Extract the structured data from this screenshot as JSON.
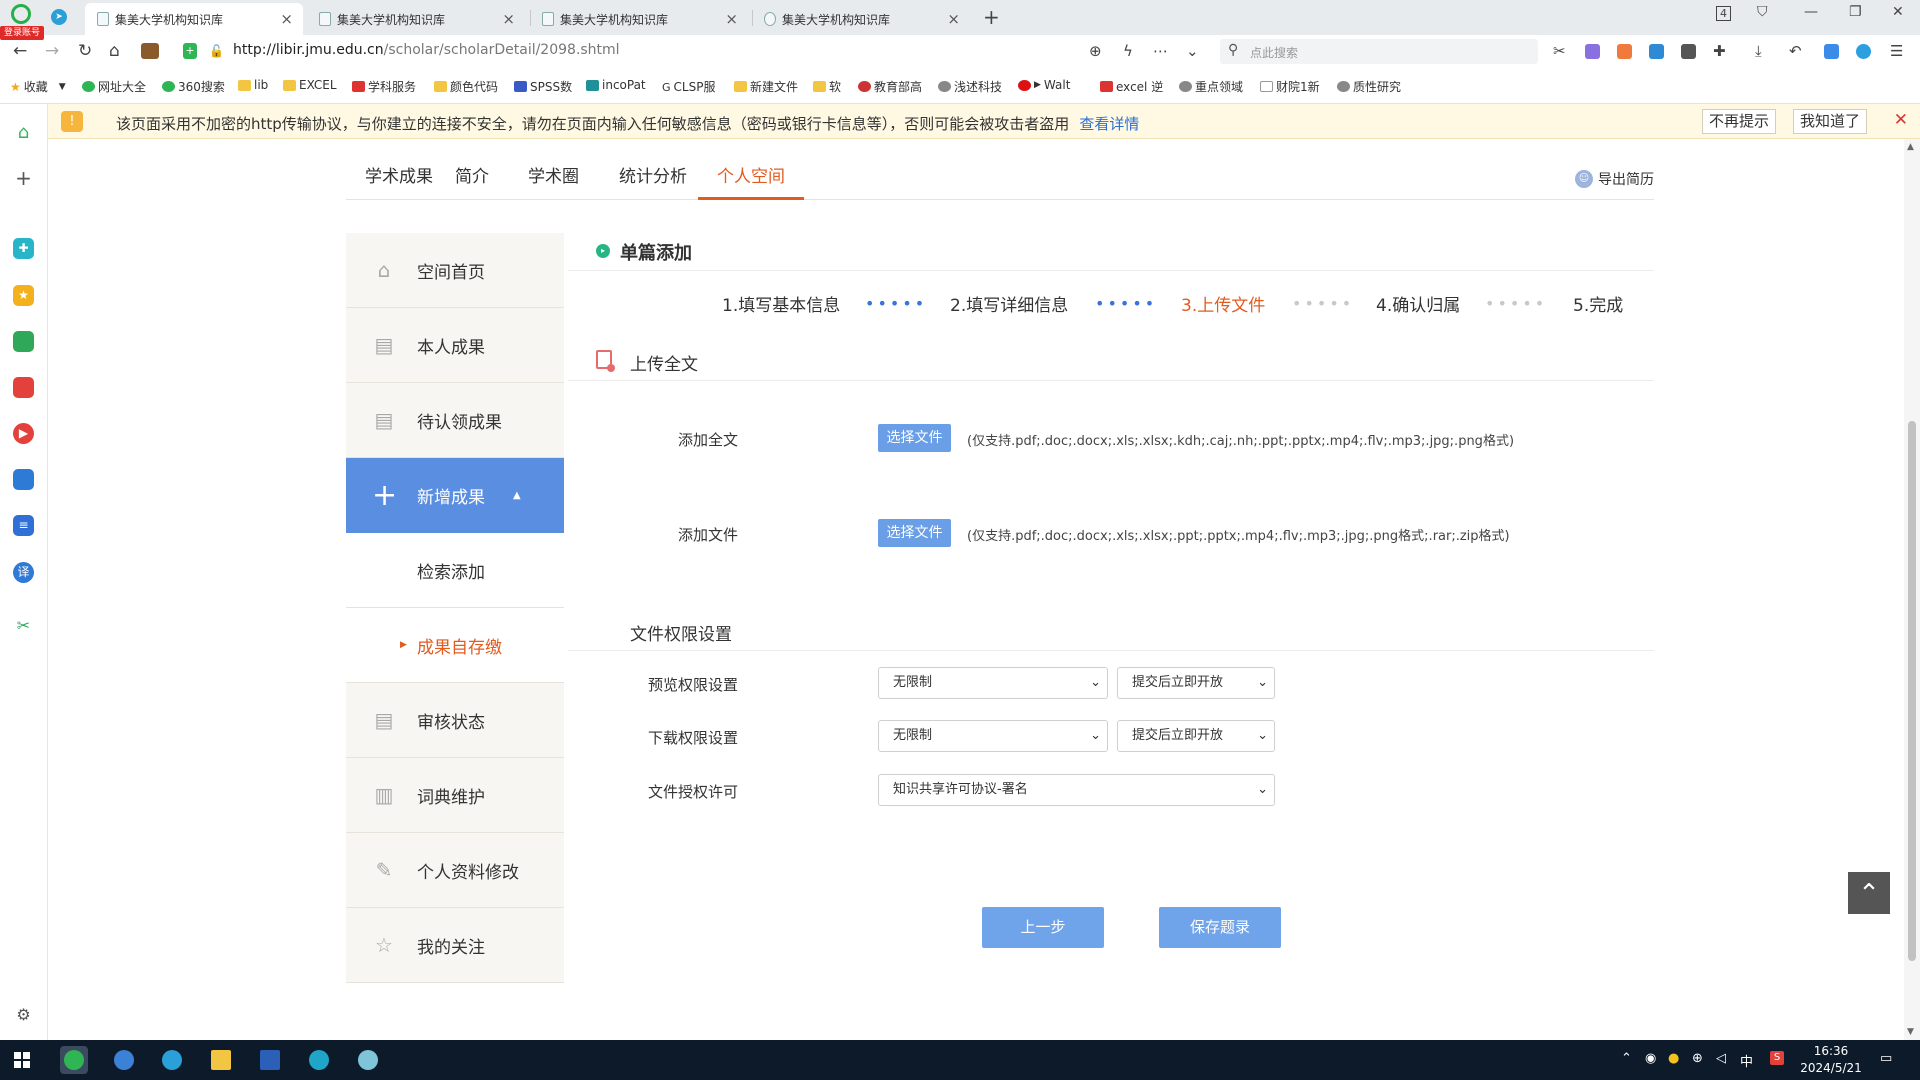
{
  "browser": {
    "login_badge": "登录账号",
    "tabs": [
      {
        "title": "集美大学机构知识库",
        "active": true
      },
      {
        "title": "集美大学机构知识库",
        "active": false
      },
      {
        "title": "集美大学机构知识库",
        "active": false
      },
      {
        "title": "集美大学机构知识库",
        "active": false
      }
    ],
    "tab_count": "4",
    "url_host": "http://libir.jmu.edu.cn",
    "url_path": "/scholar/scholarDetail/2098.shtml",
    "search_placeholder": "点此搜索",
    "bookmarks": [
      {
        "label": "收藏",
        "icon": "star-icon"
      },
      {
        "label": "网址大全",
        "icon": "globe-icon"
      },
      {
        "label": "360搜索",
        "icon": "search-icon"
      },
      {
        "label": "lib",
        "icon": "folder-icon"
      },
      {
        "label": "EXCEL",
        "icon": "folder-icon"
      },
      {
        "label": "学科服务",
        "icon": "site-icon"
      },
      {
        "label": "颜色代码",
        "icon": "folder-icon"
      },
      {
        "label": "SPSS数",
        "icon": "site-icon"
      },
      {
        "label": "incoPat",
        "icon": "site-icon"
      },
      {
        "label": "CLSP服",
        "icon": "site-icon"
      },
      {
        "label": "新建文件",
        "icon": "folder-icon"
      },
      {
        "label": "软",
        "icon": "folder-icon"
      },
      {
        "label": "教育部高",
        "icon": "site-icon"
      },
      {
        "label": "浅述科技",
        "icon": "site-icon"
      },
      {
        "label": "Walt",
        "icon": "site-icon"
      },
      {
        "label": "excel 逆",
        "icon": "site-icon"
      },
      {
        "label": "重点领域",
        "icon": "site-icon"
      },
      {
        "label": "财院1新",
        "icon": "site-icon"
      },
      {
        "label": "质性研究",
        "icon": "site-icon"
      }
    ]
  },
  "banner": {
    "message": "该页面采用不加密的http传输协议，与你建立的连接不安全，请勿在页面内输入任何敏感信息（密码或银行卡信息等），否则可能会被攻击者盗用",
    "details_link": "查看详情",
    "dont_remind": "不再提示",
    "got_it": "我知道了"
  },
  "topnav": {
    "items": [
      "学术成果",
      "简介",
      "学术圈",
      "统计分析",
      "个人空间"
    ],
    "active_index": 4,
    "export_label": "导出简历"
  },
  "sidebar_menu": {
    "items": [
      {
        "label": "空间首页",
        "icon": "home-icon"
      },
      {
        "label": "本人成果",
        "icon": "document-icon"
      },
      {
        "label": "待认领成果",
        "icon": "document-icon"
      },
      {
        "label": "新增成果",
        "icon": "plus-icon",
        "active": true
      },
      {
        "label": "检索添加",
        "sub": true
      },
      {
        "label": "成果自存缴",
        "sub": true,
        "highlighted": true
      },
      {
        "label": "审核状态",
        "icon": "document-icon"
      },
      {
        "label": "词典维护",
        "icon": "book-icon"
      },
      {
        "label": "个人资料修改",
        "icon": "edit-icon"
      },
      {
        "label": "我的关注",
        "icon": "star-outline-icon"
      }
    ]
  },
  "main": {
    "title": "单篇添加",
    "steps": [
      "1.填写基本信息",
      "2.填写详细信息",
      "3.上传文件",
      "4.确认归属",
      "5.完成"
    ],
    "current_step": 2,
    "upload_section_title": "上传全文",
    "add_fulltext_label": "添加全文",
    "add_file_label": "添加文件",
    "choose_file_label": "选择文件",
    "fulltext_formats": "(仅支持.pdf;.doc;.docx;.xls;.xlsx;.kdh;.caj;.nh;.ppt;.pptx;.mp4;.flv;.mp3;.jpg;.png格式)",
    "file_formats": "(仅支持.pdf;.doc;.docx;.xls;.xlsx;.ppt;.pptx;.mp4;.flv;.mp3;.jpg;.png格式;.rar;.zip格式)",
    "permission_section_title": "文件权限设置",
    "preview_perm_label": "预览权限设置",
    "download_perm_label": "下载权限设置",
    "license_label": "文件授权许可",
    "preview_perm_value": "无限制",
    "preview_open_value": "提交后立即开放",
    "download_perm_value": "无限制",
    "download_open_value": "提交后立即开放",
    "license_value": "知识共享许可协议-署名",
    "prev_button": "上一步",
    "save_button": "保存题录"
  },
  "taskbar": {
    "time": "16:36",
    "date": "2024/5/21",
    "ime": "中"
  },
  "colors": {
    "accent_orange": "#e25b1f",
    "menu_active_blue": "#5a8ee0",
    "button_blue": "#6fa3ea",
    "banner_bg": "#fff9e3"
  }
}
